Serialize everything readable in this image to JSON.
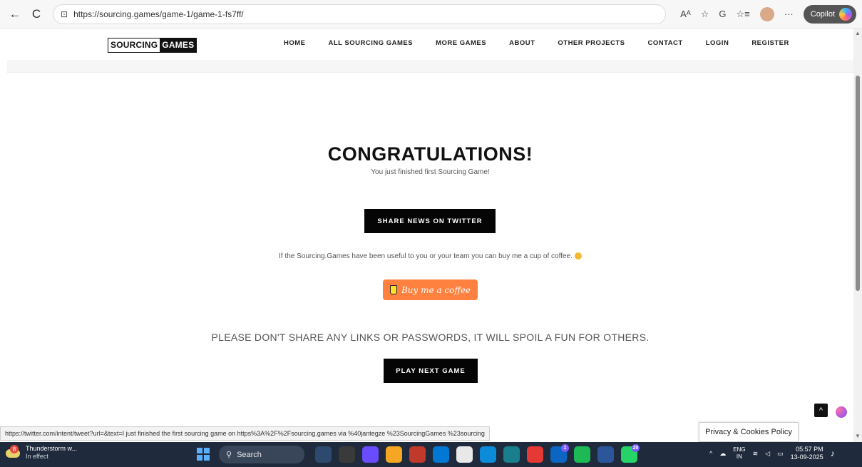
{
  "browser": {
    "url": "https://sourcing.games/game-1/game-1-fs7ff/",
    "back_glyph": "←",
    "refresh_glyph": "C",
    "lock_glyph": "⊡",
    "read_aloud_glyph": "Aᴬ",
    "favorite_glyph": "☆",
    "split_glyph": "G",
    "collections_glyph": "☆≡",
    "more_glyph": "···",
    "copilot_label": "Copilot"
  },
  "site": {
    "logo_part1": "SOURCING",
    "logo_part2": "GAMES",
    "nav": [
      "HOME",
      "ALL SOURCING GAMES",
      "MORE GAMES",
      "ABOUT",
      "OTHER PROJECTS",
      "CONTACT",
      "LOGIN",
      "REGISTER"
    ]
  },
  "main": {
    "title": "CONGRATULATIONS!",
    "subtitle": "You just finished first Sourcing Game!",
    "twitter_button": "SHARE NEWS ON TWITTER",
    "coffee_text": "If the Sourcing.Games have been useful to you or your team you can buy me a cup of coffee.",
    "coffee_button": "Buy me a coffee",
    "warning": "PLEASE DON'T SHARE ANY LINKS OR PASSWORDS, IT WILL SPOIL A FUN FOR OTHERS.",
    "next_button": "PLAY NEXT GAME"
  },
  "overlay": {
    "status_url": "https://twitter.com/intent/tweet?url=&text=I just finished the first sourcing game on https%3A%2F%2Fsourcing.games via %40jantegze %23SourcingGames %23sourcing",
    "privacy": "Privacy & Cookies Policy",
    "back_to_top": "^"
  },
  "taskbar": {
    "weather_badge": "8",
    "weather_title": "Thunderstorm w...",
    "weather_sub": "In effect",
    "search": "Search",
    "linkedin_badge": "1",
    "whatsapp_badge": "20",
    "lang_top": "ENG",
    "lang_bottom": "IN",
    "time": "05:57 PM",
    "date": "13-09-2025"
  },
  "colors": {
    "accent_black": "#050505",
    "coffee_orange": "#ff813f",
    "taskbar": "#1f2a3c"
  }
}
